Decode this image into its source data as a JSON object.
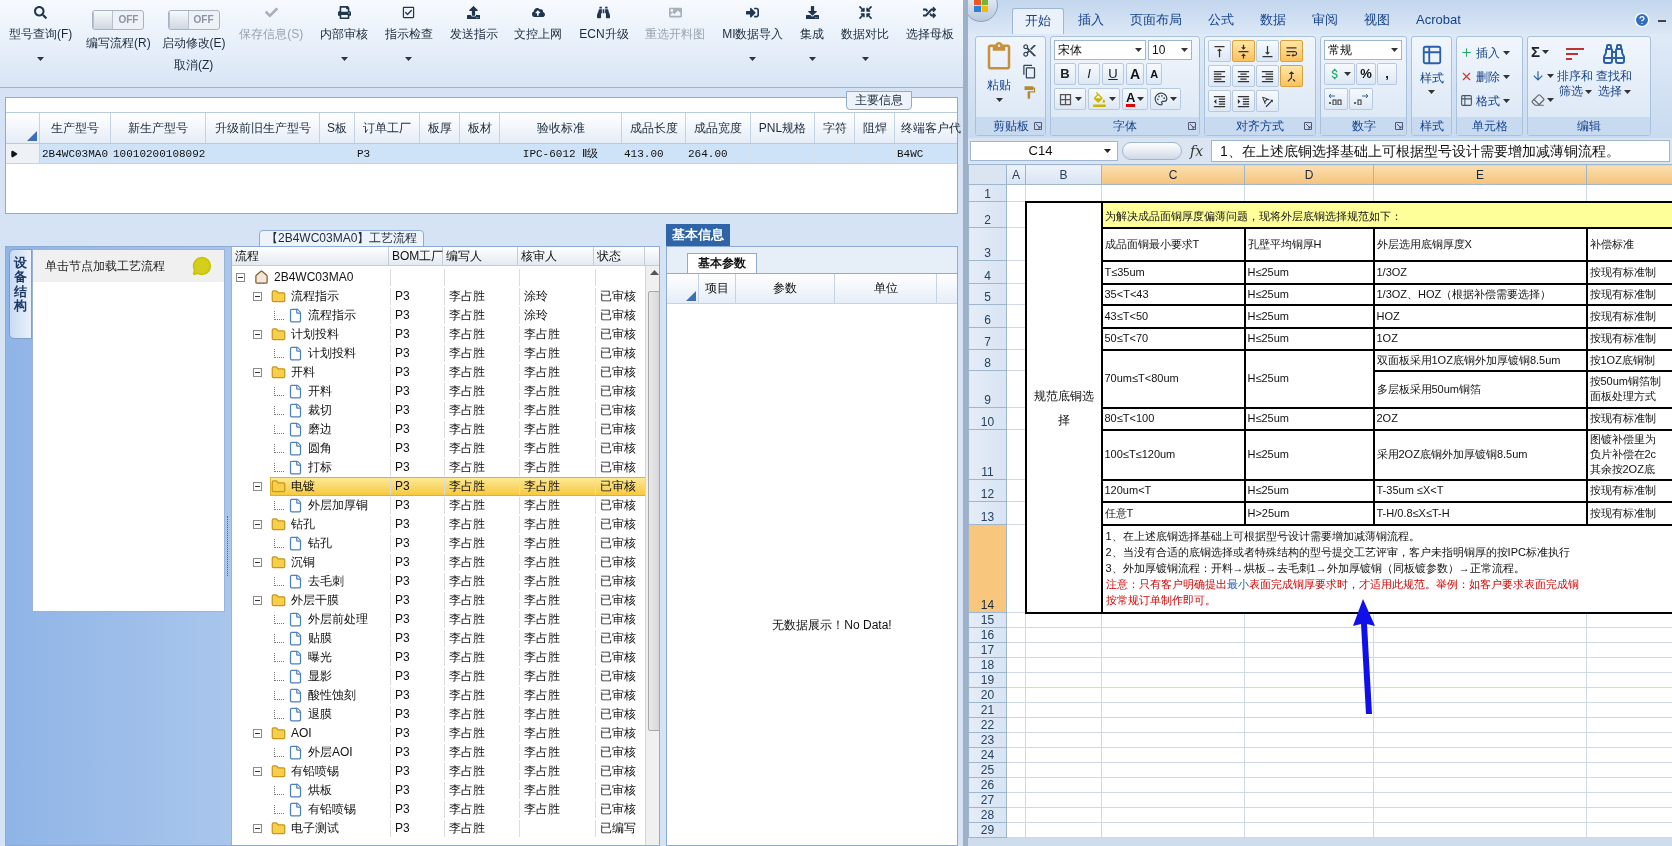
{
  "app": {
    "toolbar": [
      {
        "kind": "button",
        "label": "型号查询(F)",
        "disabled": false,
        "dropdown": true
      },
      {
        "kind": "toggle",
        "label": "编写流程(R)",
        "switch_text": "OFF",
        "on": false
      },
      {
        "kind": "toggle",
        "label": "启动修改(E)",
        "sublabel": "取消(Z)",
        "switch_text": "OFF",
        "on": false
      },
      {
        "kind": "button",
        "label": "保存信息(S)",
        "disabled": true,
        "dropdown": false
      },
      {
        "kind": "button",
        "label": "内部审核",
        "disabled": false,
        "dropdown": true
      },
      {
        "kind": "button",
        "label": "指示检查",
        "disabled": false,
        "dropdown": true
      },
      {
        "kind": "button",
        "label": "发送指示",
        "disabled": false,
        "dropdown": false
      },
      {
        "kind": "button",
        "label": "文控上网",
        "disabled": false,
        "dropdown": false
      },
      {
        "kind": "button",
        "label": "ECN升级",
        "disabled": false,
        "dropdown": false
      },
      {
        "kind": "button",
        "label": "重选开料图",
        "disabled": true,
        "dropdown": false
      },
      {
        "kind": "button",
        "label": "MI数据导入",
        "disabled": false,
        "dropdown": true
      },
      {
        "kind": "button",
        "label": "集成",
        "disabled": false,
        "dropdown": true
      },
      {
        "kind": "button",
        "label": "数据对比",
        "disabled": false,
        "dropdown": true
      },
      {
        "kind": "button",
        "label": "选择母板",
        "disabled": false,
        "dropdown": false
      }
    ],
    "main_info": {
      "tab": "主要信息",
      "columns": [
        "生产型号",
        "新生产型号",
        "升级前旧生产型号",
        "S板",
        "订单工厂",
        "板厚",
        "板材",
        "验收标准",
        "成品长度",
        "成品宽度",
        "PNL规格",
        "字符",
        "阻焊",
        "终端客户代"
      ],
      "rows": [
        {
          "selected": true,
          "cells": [
            "2B4WC03MA0",
            "10010200108092",
            null,
            null,
            "P3",
            null,
            null,
            "IPC-6012 Ⅱ级",
            "413.00",
            "264.00",
            null,
            null,
            null,
            "B4WC"
          ]
        }
      ]
    },
    "process": {
      "title": "【2B4WC03MA0】工艺流程",
      "side_tab": "设备结构",
      "side_header": "单击节点加载工艺流程",
      "columns": [
        "流程",
        "BOM工厂",
        "编写人",
        "核审人",
        "状态"
      ],
      "tree": [
        {
          "label": "2B4WC03MA0",
          "kind": "root",
          "expanded": true,
          "selected": false,
          "children": [
            {
              "label": "流程指示",
              "kind": "folder",
              "expanded": true,
              "selected": false,
              "bom": "P3",
              "writer": "李占胜",
              "reviewer": "涂玲",
              "status": "已审核",
              "children": [
                {
                  "label": "流程指示",
                  "kind": "file",
                  "selected": false,
                  "bom": "P3",
                  "writer": "李占胜",
                  "reviewer": "涂玲",
                  "status": "已审核"
                }
              ]
            },
            {
              "label": "计划投料",
              "kind": "folder",
              "expanded": true,
              "selected": false,
              "bom": "P3",
              "writer": "李占胜",
              "reviewer": "李占胜",
              "status": "已审核",
              "children": [
                {
                  "label": "计划投料",
                  "kind": "file",
                  "selected": false,
                  "bom": "P3",
                  "writer": "李占胜",
                  "reviewer": "李占胜",
                  "status": "已审核"
                }
              ]
            },
            {
              "label": "开料",
              "kind": "folder",
              "expanded": true,
              "selected": false,
              "bom": "P3",
              "writer": "李占胜",
              "reviewer": "李占胜",
              "status": "已审核",
              "children": [
                {
                  "label": "开料",
                  "kind": "file",
                  "selected": false,
                  "bom": "P3",
                  "writer": "李占胜",
                  "reviewer": "李占胜",
                  "status": "已审核"
                },
                {
                  "label": "裁切",
                  "kind": "file",
                  "selected": false,
                  "bom": "P3",
                  "writer": "李占胜",
                  "reviewer": "李占胜",
                  "status": "已审核"
                },
                {
                  "label": "磨边",
                  "kind": "file",
                  "selected": false,
                  "bom": "P3",
                  "writer": "李占胜",
                  "reviewer": "李占胜",
                  "status": "已审核"
                },
                {
                  "label": "圆角",
                  "kind": "file",
                  "selected": false,
                  "bom": "P3",
                  "writer": "李占胜",
                  "reviewer": "李占胜",
                  "status": "已审核"
                },
                {
                  "label": "打标",
                  "kind": "file",
                  "selected": false,
                  "bom": "P3",
                  "writer": "李占胜",
                  "reviewer": "李占胜",
                  "status": "已审核"
                }
              ]
            },
            {
              "label": "电镀",
              "kind": "folder",
              "expanded": true,
              "selected": true,
              "bom": "P3",
              "writer": "李占胜",
              "reviewer": "李占胜",
              "status": "已审核",
              "children": [
                {
                  "label": "外层加厚铜",
                  "kind": "file",
                  "selected": false,
                  "bom": "P3",
                  "writer": "李占胜",
                  "reviewer": "李占胜",
                  "status": "已审核"
                }
              ]
            },
            {
              "label": "钻孔",
              "kind": "folder",
              "expanded": true,
              "selected": false,
              "bom": "P3",
              "writer": "李占胜",
              "reviewer": "李占胜",
              "status": "已审核",
              "children": [
                {
                  "label": "钻孔",
                  "kind": "file",
                  "selected": false,
                  "bom": "P3",
                  "writer": "李占胜",
                  "reviewer": "李占胜",
                  "status": "已审核"
                }
              ]
            },
            {
              "label": "沉铜",
              "kind": "folder",
              "expanded": true,
              "selected": false,
              "bom": "P3",
              "writer": "李占胜",
              "reviewer": "李占胜",
              "status": "已审核",
              "children": [
                {
                  "label": "去毛刺",
                  "kind": "file",
                  "selected": false,
                  "bom": "P3",
                  "writer": "李占胜",
                  "reviewer": "李占胜",
                  "status": "已审核"
                }
              ]
            },
            {
              "label": "外层干膜",
              "kind": "folder",
              "expanded": true,
              "selected": false,
              "bom": "P3",
              "writer": "李占胜",
              "reviewer": "李占胜",
              "status": "已审核",
              "children": [
                {
                  "label": "外层前处理",
                  "kind": "file",
                  "selected": false,
                  "bom": "P3",
                  "writer": "李占胜",
                  "reviewer": "李占胜",
                  "status": "已审核"
                },
                {
                  "label": "贴膜",
                  "kind": "file",
                  "selected": false,
                  "bom": "P3",
                  "writer": "李占胜",
                  "reviewer": "李占胜",
                  "status": "已审核"
                },
                {
                  "label": "曝光",
                  "kind": "file",
                  "selected": false,
                  "bom": "P3",
                  "writer": "李占胜",
                  "reviewer": "李占胜",
                  "status": "已审核"
                },
                {
                  "label": "显影",
                  "kind": "file",
                  "selected": false,
                  "bom": "P3",
                  "writer": "李占胜",
                  "reviewer": "李占胜",
                  "status": "已审核"
                },
                {
                  "label": "酸性蚀刻",
                  "kind": "file",
                  "selected": false,
                  "bom": "P3",
                  "writer": "李占胜",
                  "reviewer": "李占胜",
                  "status": "已审核"
                },
                {
                  "label": "退膜",
                  "kind": "file",
                  "selected": false,
                  "bom": "P3",
                  "writer": "李占胜",
                  "reviewer": "李占胜",
                  "status": "已审核"
                }
              ]
            },
            {
              "label": "AOI",
              "kind": "folder",
              "expanded": true,
              "selected": false,
              "bom": "P3",
              "writer": "李占胜",
              "reviewer": "李占胜",
              "status": "已审核",
              "children": [
                {
                  "label": "外层AOI",
                  "kind": "file",
                  "selected": false,
                  "bom": "P3",
                  "writer": "李占胜",
                  "reviewer": "李占胜",
                  "status": "已审核"
                }
              ]
            },
            {
              "label": "有铅喷锡",
              "kind": "folder",
              "expanded": true,
              "selected": false,
              "bom": "P3",
              "writer": "李占胜",
              "reviewer": "李占胜",
              "status": "已审核",
              "children": [
                {
                  "label": "烘板",
                  "kind": "file",
                  "selected": false,
                  "bom": "P3",
                  "writer": "李占胜",
                  "reviewer": "李占胜",
                  "status": "已审核"
                },
                {
                  "label": "有铅喷锡",
                  "kind": "file",
                  "selected": false,
                  "bom": "P3",
                  "writer": "李占胜",
                  "reviewer": "李占胜",
                  "status": "已审核"
                }
              ]
            },
            {
              "label": "电子测试",
              "kind": "folder",
              "expanded": true,
              "selected": false,
              "bom": "P3",
              "writer": "李占胜",
              "status": "已编写"
            }
          ]
        }
      ]
    },
    "details": {
      "tab": "基本信息",
      "subtab": "基本参数",
      "columns": [
        "项目",
        "参数",
        "单位"
      ],
      "empty_text": "无数据展示！No Data!"
    }
  },
  "excel": {
    "tabs": [
      {
        "label": "开始",
        "selected": true
      },
      {
        "label": "插入",
        "selected": false
      },
      {
        "label": "页面布局",
        "selected": false
      },
      {
        "label": "公式",
        "selected": false
      },
      {
        "label": "数据",
        "selected": false
      },
      {
        "label": "审阅",
        "selected": false
      },
      {
        "label": "视图",
        "selected": false
      },
      {
        "label": "Acrobat",
        "selected": false
      }
    ],
    "clipboard": {
      "label": "剪贴板",
      "paste": "粘贴"
    },
    "font": {
      "label": "字体",
      "name": "宋体",
      "size": "10",
      "styles": [
        {
          "label": "B",
          "on": false
        },
        {
          "label": "I",
          "on": false
        },
        {
          "label": "U",
          "on": false
        }
      ],
      "grow": "A",
      "shrink": "A",
      "color_letter": "A"
    },
    "alignment": {
      "label": "对齐方式",
      "buttons": [
        {
          "on": false
        },
        {
          "on": true
        },
        {
          "on": false
        },
        {
          "on": true
        },
        {
          "on": false
        },
        {
          "on": false
        },
        {
          "on": false
        },
        {
          "on": true
        },
        {
          "on": false
        },
        {
          "on": false
        },
        {
          "on": false
        }
      ]
    },
    "number": {
      "label": "数字",
      "format": "常规",
      "symbols": [
        "%",
        ","
      ]
    },
    "styles": {
      "label": "样式",
      "button": "样式"
    },
    "cells": {
      "label": "单元格",
      "buttons": [
        "插入",
        "删除",
        "格式"
      ]
    },
    "editing": {
      "label": "编辑",
      "autosum": "Σ",
      "buttons": [
        [
          "排序和",
          "筛选"
        ],
        [
          "查找和",
          "选择"
        ]
      ]
    },
    "name_box": "C14",
    "function_symbol": "fx",
    "formula": "1、在上述底铜选择基础上可根据型号设计需要增加减薄铜流程。",
    "sheet": {
      "column_letters": [
        {
          "label": "A",
          "selected": false
        },
        {
          "label": "B",
          "selected": false
        },
        {
          "label": "C",
          "selected": true
        },
        {
          "label": "D",
          "selected": true
        },
        {
          "label": "E",
          "selected": true
        },
        {
          "selected": true
        }
      ],
      "row_numbers": [
        {
          "label": "1",
          "selected": false
        },
        {
          "label": "2",
          "selected": false
        },
        {
          "label": "3",
          "selected": false
        },
        {
          "label": "4",
          "selected": false
        },
        {
          "label": "5",
          "selected": false
        },
        {
          "label": "6",
          "selected": false
        },
        {
          "label": "7",
          "selected": false
        },
        {
          "label": "8",
          "selected": false
        },
        {
          "label": "9",
          "selected": false
        },
        {
          "label": "10",
          "selected": false
        },
        {
          "label": "11",
          "selected": false
        },
        {
          "label": "12",
          "selected": false
        },
        {
          "label": "13",
          "selected": false
        },
        {
          "label": "14",
          "selected": true
        },
        {
          "label": "15",
          "selected": false
        },
        {
          "label": "16",
          "selected": false
        },
        {
          "label": "17",
          "selected": false
        },
        {
          "label": "18",
          "selected": false
        },
        {
          "label": "19",
          "selected": false
        },
        {
          "label": "20",
          "selected": false
        },
        {
          "label": "21",
          "selected": false
        },
        {
          "label": "22",
          "selected": false
        },
        {
          "label": "23",
          "selected": false
        },
        {
          "label": "24",
          "selected": false
        },
        {
          "label": "25",
          "selected": false
        },
        {
          "label": "26",
          "selected": false
        },
        {
          "label": "27",
          "selected": false
        },
        {
          "label": "28",
          "selected": false
        },
        {
          "label": "29",
          "selected": false
        }
      ],
      "section_label": "规范底铜选择",
      "banner": "为解决成品面铜厚度偏薄问题，现将外层底铜选择规范如下：",
      "table_header": [
        "成品面铜最小要求T",
        "孔壁平均铜厚H",
        "外层选用底铜厚度X",
        "补偿标准"
      ],
      "rows": [
        {
          "kind": "single",
          "cells": [
            "T≤35um",
            "H≤25um",
            "1/3OZ",
            "按现有标准制"
          ]
        },
        {
          "kind": "single",
          "cells": [
            "35<T<43",
            "H≤25um",
            "1/3OZ、HOZ（根据补偿需要选择）",
            "按现有标准制"
          ]
        },
        {
          "kind": "single",
          "cells": [
            "43≤T<50",
            "H≤25um",
            "HOZ",
            "按现有标准制"
          ]
        },
        {
          "kind": "single",
          "cells": [
            "50≤T<70",
            "H≤25um",
            "1OZ",
            "按现有标准制"
          ]
        },
        {
          "kind": "split",
          "cells": [
            "70um≤T<80um",
            "H≤25um"
          ],
          "sub_rows": [
            [
              "双面板采用1OZ底铜外加厚镀铜8.5um",
              "按1OZ底铜制"
            ],
            [
              "多层板采用50um铜箔",
              [
                "按50um铜箔制",
                "面板处理方式"
              ]
            ]
          ]
        },
        {
          "kind": "single",
          "cells": [
            "80≤T<100",
            "H≤25um",
            "2OZ",
            "按现有标准制"
          ]
        },
        {
          "kind": "single",
          "cells": [
            "100≤T≤120um",
            "H≤25um",
            "采用2OZ底铜外加厚镀铜8.5um",
            [
              "图镀补偿里为",
              "负片补偿在2c",
              "其余按2OZ底"
            ]
          ]
        },
        {
          "kind": "single",
          "cells": [
            "120um<T",
            "H≤25um",
            "T-35um ≤X<T",
            "按现有标准制"
          ]
        },
        {
          "kind": "single",
          "cells": [
            "任意T",
            "H>25um",
            "T-H/0.8≤X≤T-H",
            "按现有标准制"
          ]
        }
      ],
      "notes": [
        {
          "parts": [
            {
              "kind": "normal",
              "text": "1、在上述底铜选择基础上可根据型号设计需要增加减薄铜流程。"
            }
          ]
        },
        {
          "parts": [
            {
              "kind": "normal",
              "text": "2、当没有合适的底铜选择或者特殊结构的型号提交工艺评审，客户未指明铜厚的按IPC标准执行"
            }
          ]
        },
        {
          "parts": [
            {
              "kind": "normal",
              "text": "3、外加厚镀铜流程：开料→烘板→去毛刺1→外加厚镀铜（同板镀参数）→正常流程。"
            }
          ]
        },
        {
          "parts": [
            {
              "kind": "warning",
              "text": "注意：只有客户明确提出"
            },
            {
              "kind": "emphasis",
              "text": "最小"
            },
            {
              "kind": "warning",
              "text": "表面完成铜厚要求时，才适用此规范。举例：如客户要求表面完成铜"
            }
          ]
        },
        {
          "parts": [
            {
              "kind": "warning",
              "text": "按常规订单制作即可。"
            }
          ]
        }
      ]
    }
  }
}
